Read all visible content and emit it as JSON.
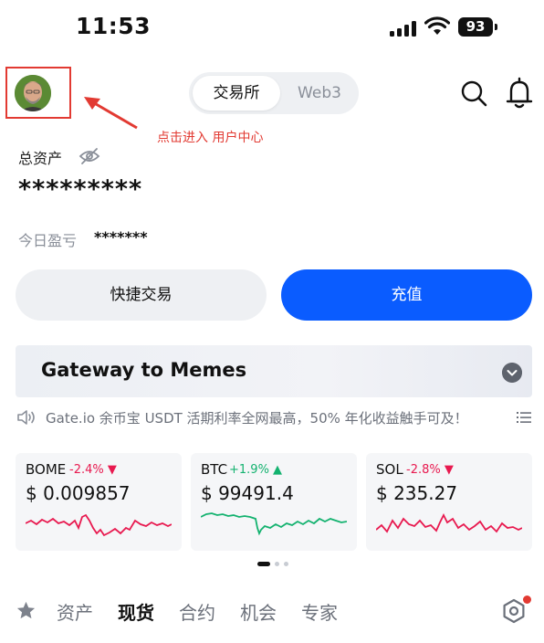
{
  "status_bar": {
    "time": "11:53",
    "battery": "93"
  },
  "header": {
    "segments": [
      {
        "label": "交易所",
        "active": true
      },
      {
        "label": "Web3",
        "active": false
      }
    ],
    "icons": [
      "search-icon",
      "bell-icon"
    ]
  },
  "annotation": {
    "text": "点击进入 用户中心",
    "color": "#e23a32"
  },
  "assets": {
    "label": "总资产",
    "value": "*********",
    "pnl_label": "今日盈亏",
    "pnl_value": "*******"
  },
  "actions": {
    "quick_trade": "快捷交易",
    "deposit": "充值",
    "deposit_color": "#0a5cff"
  },
  "banner": {
    "title": "Gateway to Memes"
  },
  "notice": {
    "text": "Gate.io 余币宝 USDT 活期利率全网最高，50% 年化收益触手可及！"
  },
  "tickers": [
    {
      "symbol": "BOME",
      "change": "-2.4%",
      "direction": "down",
      "price": "$ 0.009857",
      "color": "#e8194f"
    },
    {
      "symbol": "BTC",
      "change": "+1.9%",
      "direction": "up",
      "price": "$ 99491.4",
      "color": "#13b26f"
    },
    {
      "symbol": "SOL",
      "change": "-2.8%",
      "direction": "down",
      "price": "$ 235.27",
      "color": "#e8194f"
    }
  ],
  "pagination": {
    "pages": 3,
    "active": 1
  },
  "bottom_tabs": [
    {
      "label": "资产",
      "active": false
    },
    {
      "label": "现货",
      "active": true
    },
    {
      "label": "合约",
      "active": false
    },
    {
      "label": "机会",
      "active": false
    },
    {
      "label": "专家",
      "active": false
    }
  ]
}
